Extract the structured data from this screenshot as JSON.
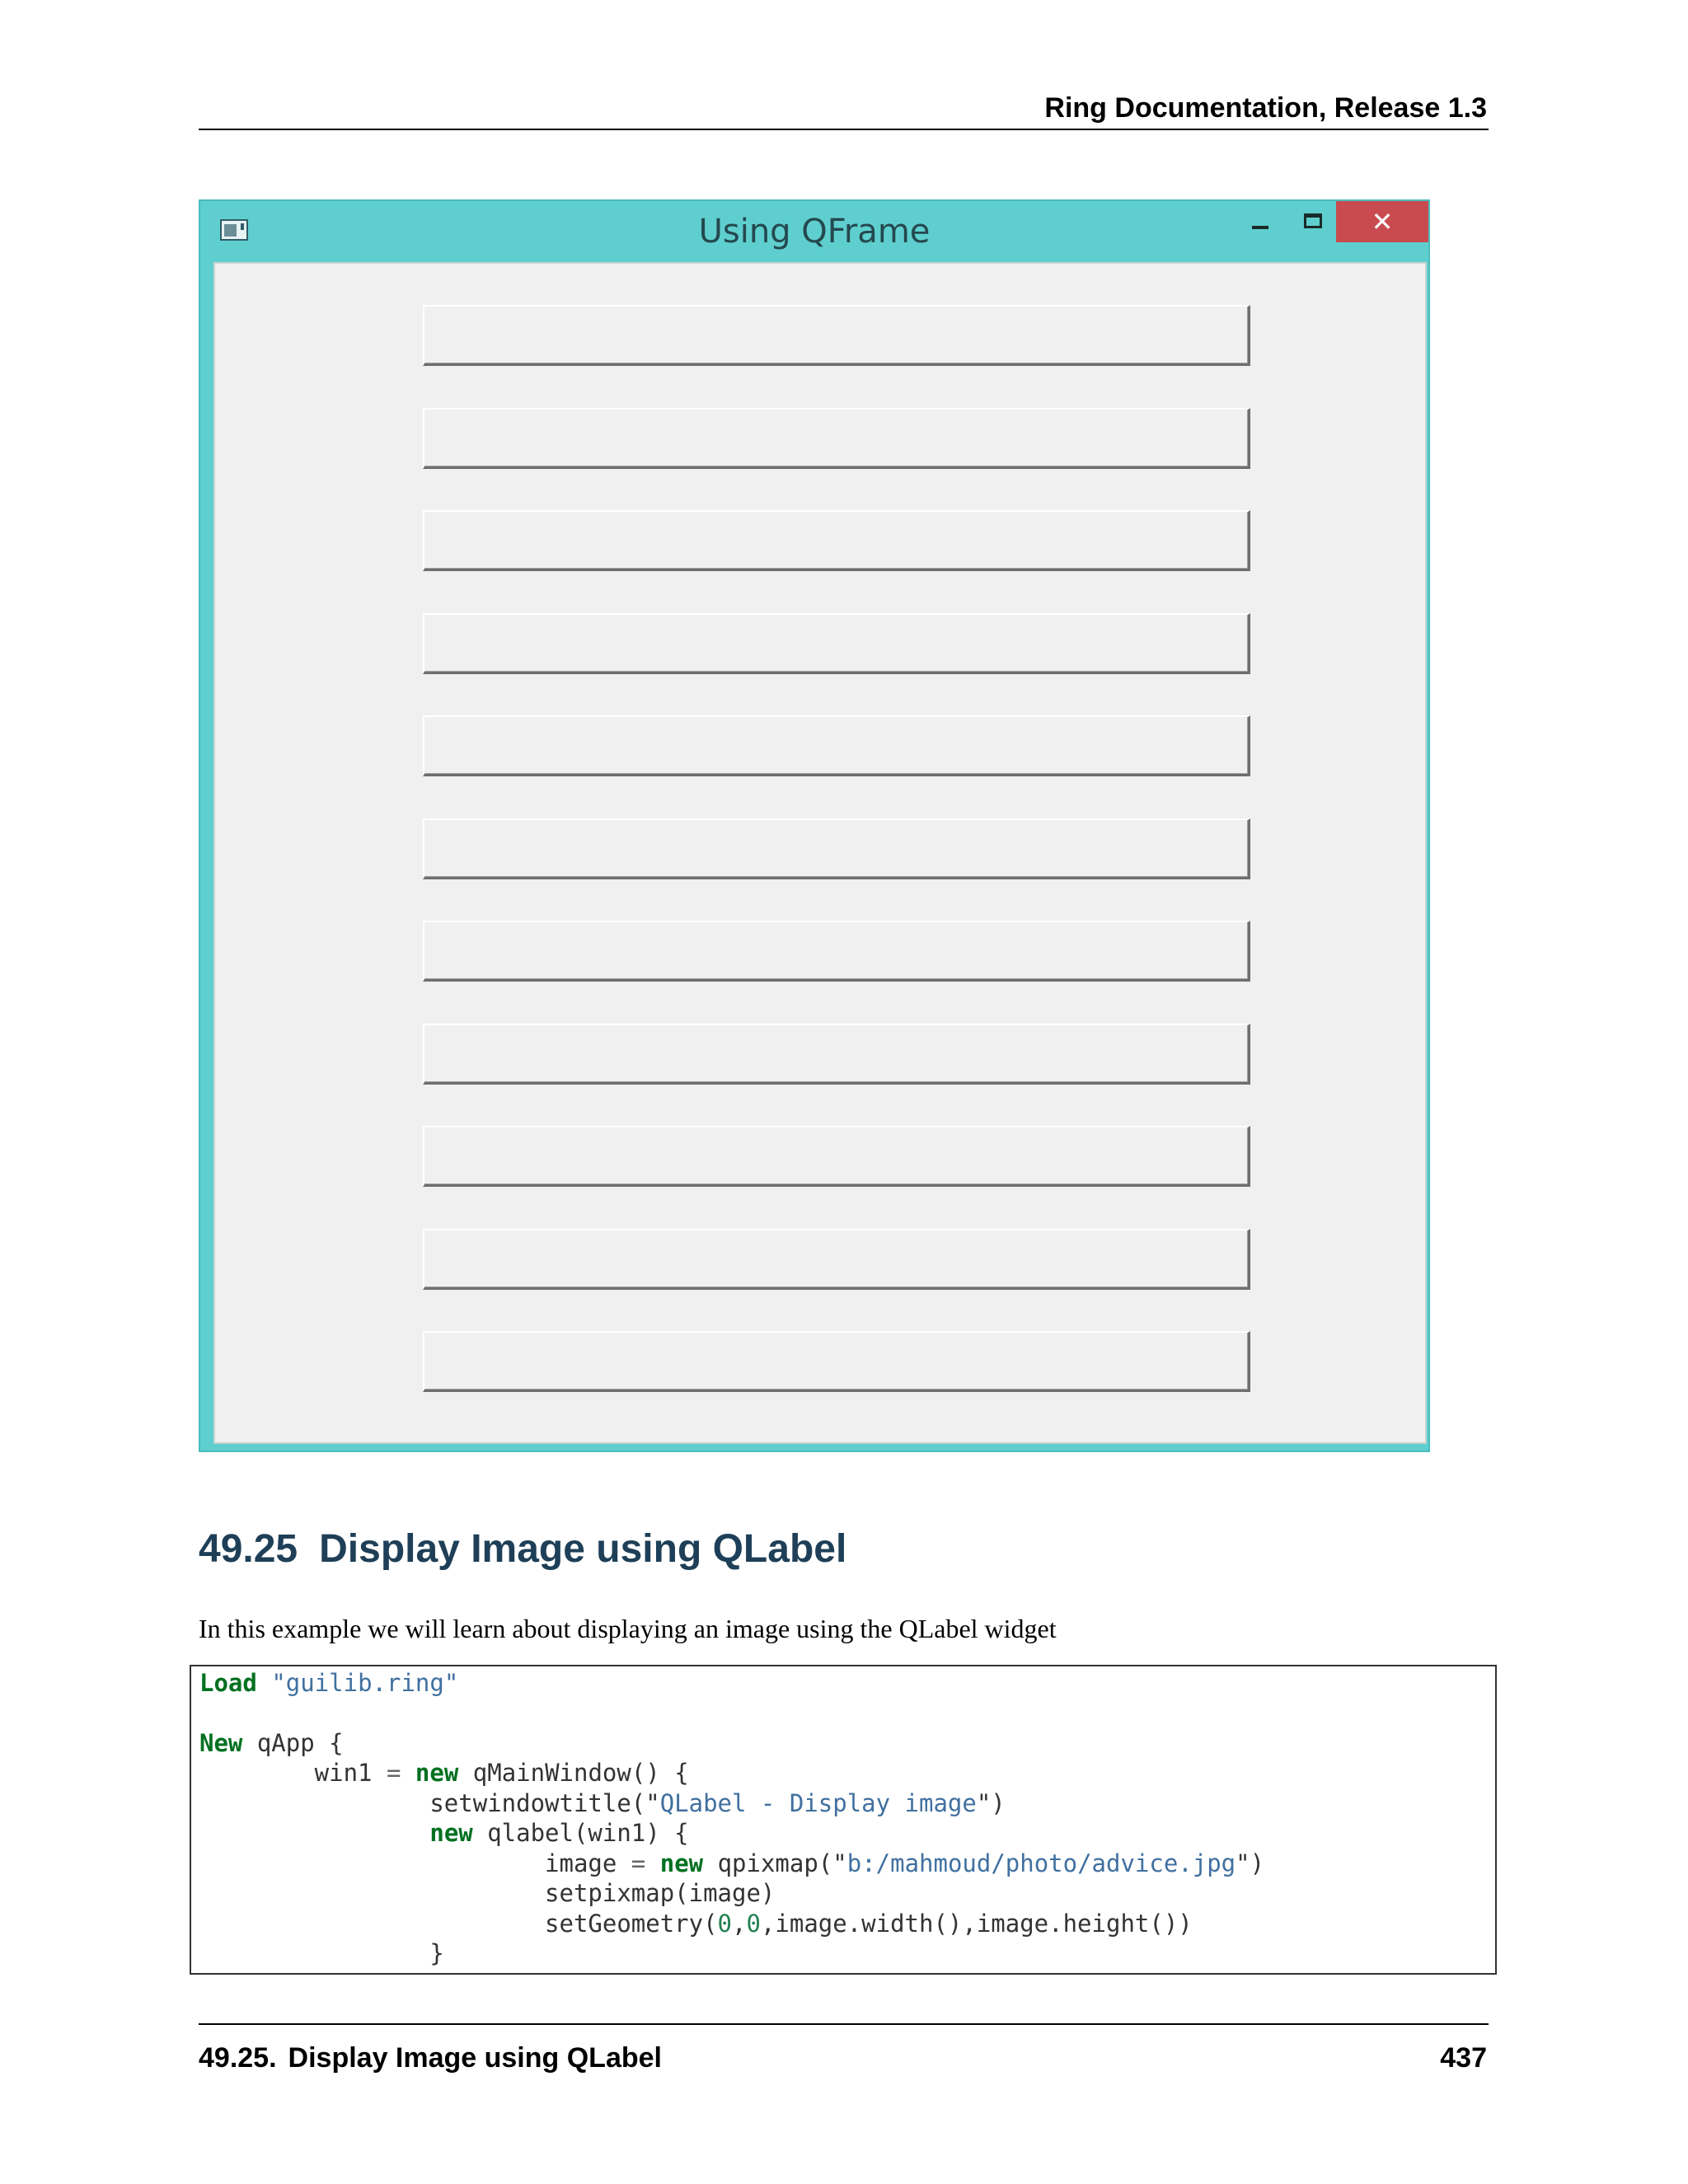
{
  "header": {
    "title": "Ring Documentation, Release 1.3"
  },
  "window": {
    "title": "Using QFrame",
    "close_glyph": "✕",
    "frame_count": 11
  },
  "section": {
    "number": "49.25",
    "title": "Display Image using QLabel",
    "intro": "In this example we will learn about displaying an image using the QLabel widget"
  },
  "code": {
    "l1": {
      "kw": "Load",
      "str": "\"guilib.ring\""
    },
    "l3": {
      "kw": "New",
      "rest": " qApp {"
    },
    "l4": {
      "pre": "        win1 ",
      "eq": "=",
      "sp": " ",
      "kw": "new",
      "rest": " qMainWindow() {"
    },
    "l5": {
      "pre": "                setwindowtitle(",
      "q1": "\"",
      "s": "QLabel - Display image",
      "q2": "\"",
      "rest": ")"
    },
    "l6": {
      "pre": "                ",
      "kw": "new",
      "rest": " qlabel(win1) {"
    },
    "l7": {
      "pre": "                        image ",
      "eq": "=",
      "sp": " ",
      "kw": "new",
      "mid": " qpixmap(",
      "q1": "\"",
      "s": "b:/mahmoud/photo/advice.jpg",
      "q2": "\"",
      "rest": ")"
    },
    "l8": {
      "text": "                        setpixmap(image)"
    },
    "l9": {
      "pre": "                        setGeometry(",
      "n1": "0",
      "c1": ",",
      "n2": "0",
      "rest": ",image.width(),image.height())"
    },
    "l10": {
      "text": "                }"
    }
  },
  "footer": {
    "section": "49.25.",
    "title": "Display Image using QLabel",
    "page": "437"
  }
}
